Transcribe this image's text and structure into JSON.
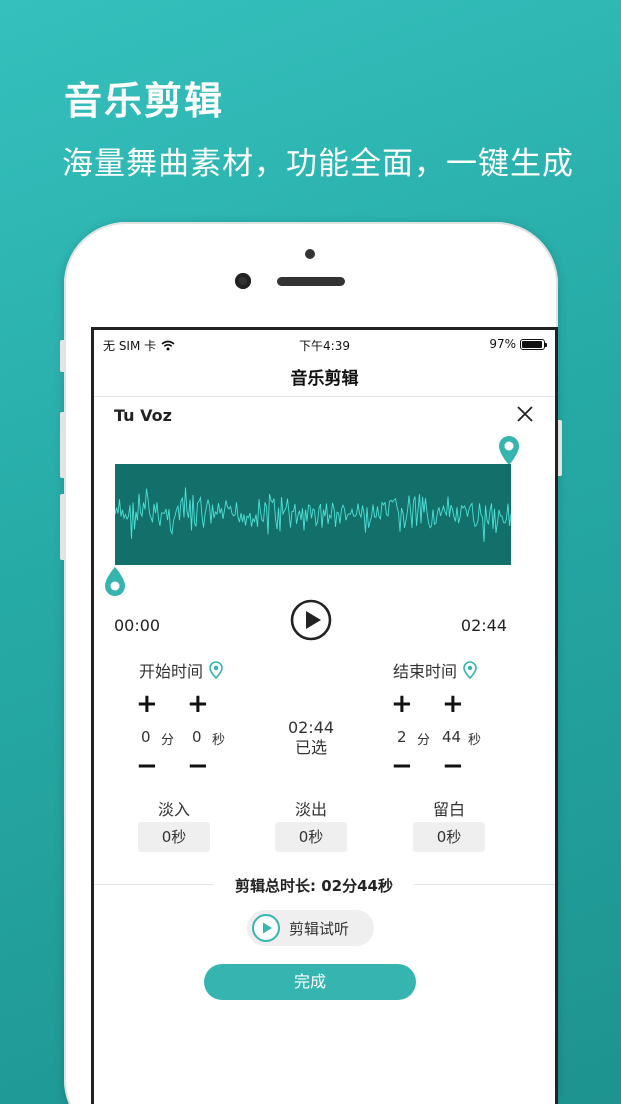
{
  "promo": {
    "headline": "音乐剪辑",
    "subline": "海量舞曲素材，功能全面，一键生成"
  },
  "status_bar": {
    "carrier": "无 SIM 卡",
    "time": "下午4:39",
    "battery": "97%",
    "battery_level": 0.97
  },
  "nav": {
    "title": "音乐剪辑"
  },
  "song": {
    "title": "Tu Voz"
  },
  "player": {
    "current_time": "00:00",
    "total_time": "02:44"
  },
  "trim": {
    "start_label": "开始时间",
    "end_label": "结束时间",
    "plus": "+",
    "minus": "−",
    "start_min": "0",
    "start_sec": "0",
    "end_min": "2",
    "end_sec": "44",
    "min_unit": "分",
    "sec_unit": "秒",
    "selected_time": "02:44",
    "selected_label": "已选"
  },
  "fade": {
    "fade_in_label": "淡入",
    "fade_in_value": "0秒",
    "fade_out_label": "淡出",
    "fade_out_value": "0秒",
    "silence_label": "留白",
    "silence_value": "0秒"
  },
  "summary": {
    "duration_text": "剪辑总时长: 02分44秒"
  },
  "actions": {
    "preview_label": "剪辑试听",
    "done_label": "完成"
  },
  "colors": {
    "accent": "#36b5b0",
    "waveform_bg": "#136f6a",
    "waveform_line": "#4ee0d6",
    "background_top": "#35c0bd",
    "background_bottom": "#1e938f"
  }
}
